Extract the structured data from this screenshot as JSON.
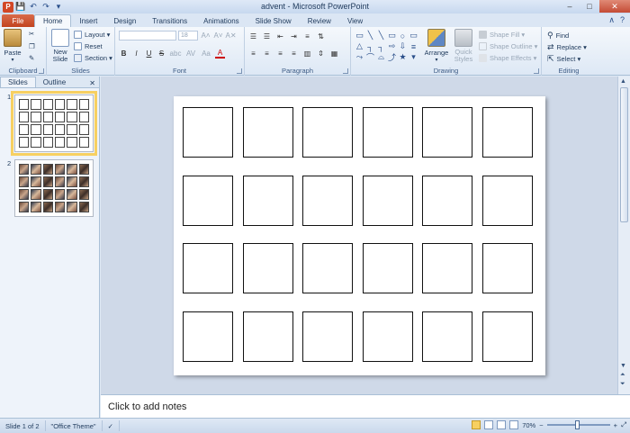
{
  "window": {
    "title": "advent - Microsoft PowerPoint",
    "app_logo": "P",
    "min": "–",
    "max": "□",
    "close": "✕"
  },
  "qat": {
    "save": "💾",
    "undo": "↶",
    "redo": "↷",
    "customize": "▾"
  },
  "tabs": {
    "file": "File",
    "items": [
      "Home",
      "Insert",
      "Design",
      "Transitions",
      "Animations",
      "Slide Show",
      "Review",
      "View"
    ],
    "active": "Home",
    "right_icons": {
      "minimize_ribbon": "∧",
      "help": "?"
    }
  },
  "ribbon": {
    "clipboard": {
      "label": "Clipboard",
      "paste": "Paste",
      "cut": "✂",
      "copy": "❐",
      "painter": "✎"
    },
    "slides": {
      "label": "Slides",
      "new_slide": "New Slide",
      "layout": "Layout ▾",
      "reset": "Reset",
      "section": "Section ▾"
    },
    "font": {
      "label": "Font",
      "font_name": "",
      "font_size": "18",
      "grow": "A˄",
      "shrink": "A˅",
      "clear": "A✕",
      "bold": "B",
      "italic": "I",
      "underline": "U",
      "strike": "S",
      "shadow": "abc",
      "spacing": "AV",
      "case": "Aa",
      "color": "A"
    },
    "paragraph": {
      "label": "Paragraph"
    },
    "drawing": {
      "label": "Drawing",
      "arrange": "Arrange",
      "quick_styles": "Quick Styles",
      "shape_fill": "Shape Fill ▾",
      "shape_outline": "Shape Outline ▾",
      "shape_effects": "Shape Effects ▾",
      "shapes": [
        "▭",
        "╲",
        "╲",
        "▭",
        "○",
        "▭",
        "△",
        "┐",
        "┐",
        "⇨",
        "⇩",
        "≡",
        "⤳",
        "⌒",
        "⌓",
        "⤴",
        "★",
        "▾"
      ]
    },
    "editing": {
      "label": "Editing",
      "find": "Find",
      "replace": "Replace ▾",
      "select": "Select ▾"
    }
  },
  "left_pane": {
    "tab_slides": "Slides",
    "tab_outline": "Outline",
    "close": "✕",
    "thumbs": [
      {
        "num": "1"
      },
      {
        "num": "2"
      }
    ]
  },
  "slide": {
    "rows": 4,
    "cols": 6
  },
  "notes": {
    "placeholder": "Click to add notes"
  },
  "status": {
    "slide_info": "Slide 1 of 2",
    "theme": "\"Office Theme\"",
    "zoom": "70%",
    "zoom_minus": "−",
    "zoom_plus": "+"
  }
}
